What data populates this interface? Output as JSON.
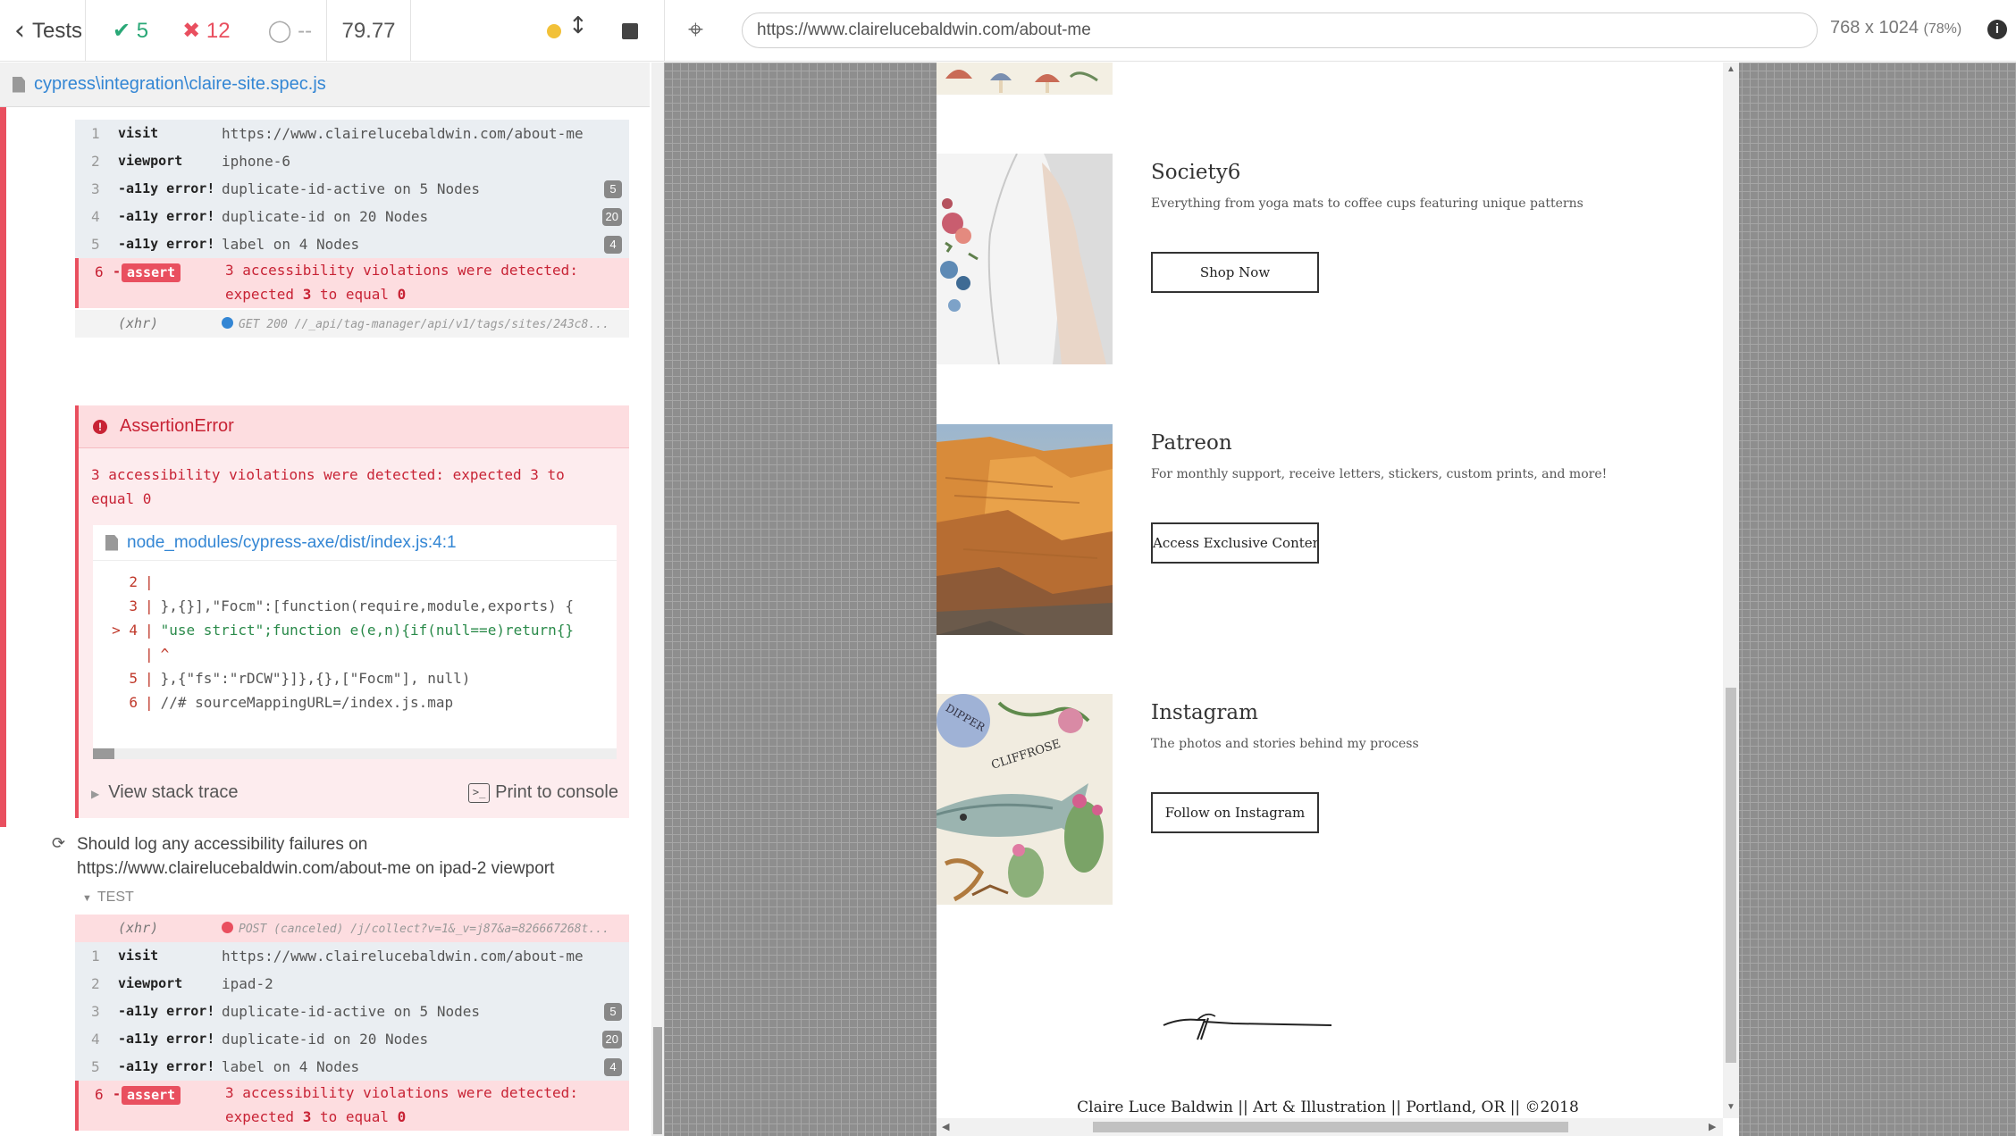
{
  "topbar": {
    "back_label": "Tests",
    "passed": "5",
    "failed": "12",
    "pending": "--",
    "duration": "79.77",
    "url": "https://www.clairelucebaldwin.com/about-me",
    "viewport_size": "768 x 1024",
    "viewport_scale": "(78%)"
  },
  "spec": {
    "file": "cypress\\integration\\claire-site.spec.js"
  },
  "test1": {
    "commands": [
      {
        "num": "1",
        "name": "visit",
        "message": "https://www.clairelucebaldwin.com/about-me",
        "badge": ""
      },
      {
        "num": "2",
        "name": "viewport",
        "message": "iphone-6",
        "badge": ""
      },
      {
        "num": "3",
        "name": "-a11y error!",
        "message": "duplicate-id-active on 5 Nodes",
        "badge": "5"
      },
      {
        "num": "4",
        "name": "-a11y error!",
        "message": "duplicate-id on 20 Nodes",
        "badge": "20"
      },
      {
        "num": "5",
        "name": "-a11y error!",
        "message": "label on 4 Nodes",
        "badge": "4"
      }
    ],
    "assert": {
      "num": "6",
      "dash": "-",
      "tag": "assert",
      "line1": "3 accessibility violations were detected:",
      "line2_pre": "expected ",
      "line2_a": "3",
      "line2_mid": " to equal ",
      "line2_b": "0"
    },
    "xhr": {
      "label": "(xhr)",
      "message": "GET 200 //_api/tag-manager/api/v1/tags/sites/243c8...",
      "dot_color": "#3386d4"
    }
  },
  "error": {
    "title": "AssertionError",
    "message_line1": "3 accessibility violations were detected: expected 3 to",
    "message_line2": "equal 0",
    "file": "node_modules/cypress-axe/dist/index.js:4:1",
    "code_lines": [
      {
        "marker": "",
        "num": "2",
        "code": ""
      },
      {
        "marker": "",
        "num": "3",
        "code": "},{}],\"Focm\":[function(require,module,exports) {"
      },
      {
        "marker": ">",
        "num": "4",
        "code": "\"use strict\";function e(e,n){if(null==e)return{}"
      },
      {
        "marker": "",
        "num": "",
        "code": "^"
      },
      {
        "marker": "",
        "num": "5",
        "code": "},{\"fs\":\"rDCW\"}]},{},[\"Focm\"], null)"
      },
      {
        "marker": "",
        "num": "6",
        "code": "//# sourceMappingURL=/index.js.map"
      }
    ],
    "view_stack": "View stack trace",
    "print_console": "Print to console"
  },
  "test2": {
    "title": "Should log any accessibility failures on https://www.clairelucebaldwin.com/about-me on ipad-2 viewport",
    "section_label": "TEST",
    "xhr": {
      "label": "(xhr)",
      "message": "POST (canceled) /j/collect?v=1&_v=j87&a=826667268t...",
      "dot_color": "#e94f5f"
    },
    "commands": [
      {
        "num": "1",
        "name": "visit",
        "message": "https://www.clairelucebaldwin.com/about-me",
        "badge": ""
      },
      {
        "num": "2",
        "name": "viewport",
        "message": "ipad-2",
        "badge": ""
      },
      {
        "num": "3",
        "name": "-a11y error!",
        "message": "duplicate-id-active on 5 Nodes",
        "badge": "5"
      },
      {
        "num": "4",
        "name": "-a11y error!",
        "message": "duplicate-id on 20 Nodes",
        "badge": "20"
      },
      {
        "num": "5",
        "name": "-a11y error!",
        "message": "label on 4 Nodes",
        "badge": "4"
      }
    ],
    "assert": {
      "num": "6",
      "dash": "-",
      "tag": "assert",
      "line1": "3 accessibility violations were detected:",
      "line2_pre": "expected ",
      "line2_a": "3",
      "line2_mid": " to equal ",
      "line2_b": "0"
    }
  },
  "site": {
    "items": [
      {
        "title": "Society6",
        "description": "Everything from yoga mats to coffee cups featuring unique patterns",
        "button": "Shop Now"
      },
      {
        "title": "Patreon",
        "description": "For monthly support, receive letters, stickers, custom prints, and more!",
        "button": "Access Exclusive Content"
      },
      {
        "title": "Instagram",
        "description": "The photos and stories behind my process",
        "button": "Follow on Instagram"
      }
    ],
    "footer": "Claire Luce Baldwin || Art & Illustration || Portland, OR || ©2018",
    "illustration_labels": [
      "DIPPER",
      "CLIFFROSE"
    ]
  },
  "colors": {
    "pass": "#2aa877",
    "fail": "#e94f5f",
    "link": "#3386d4",
    "pending_indicator": "#f2c138"
  }
}
